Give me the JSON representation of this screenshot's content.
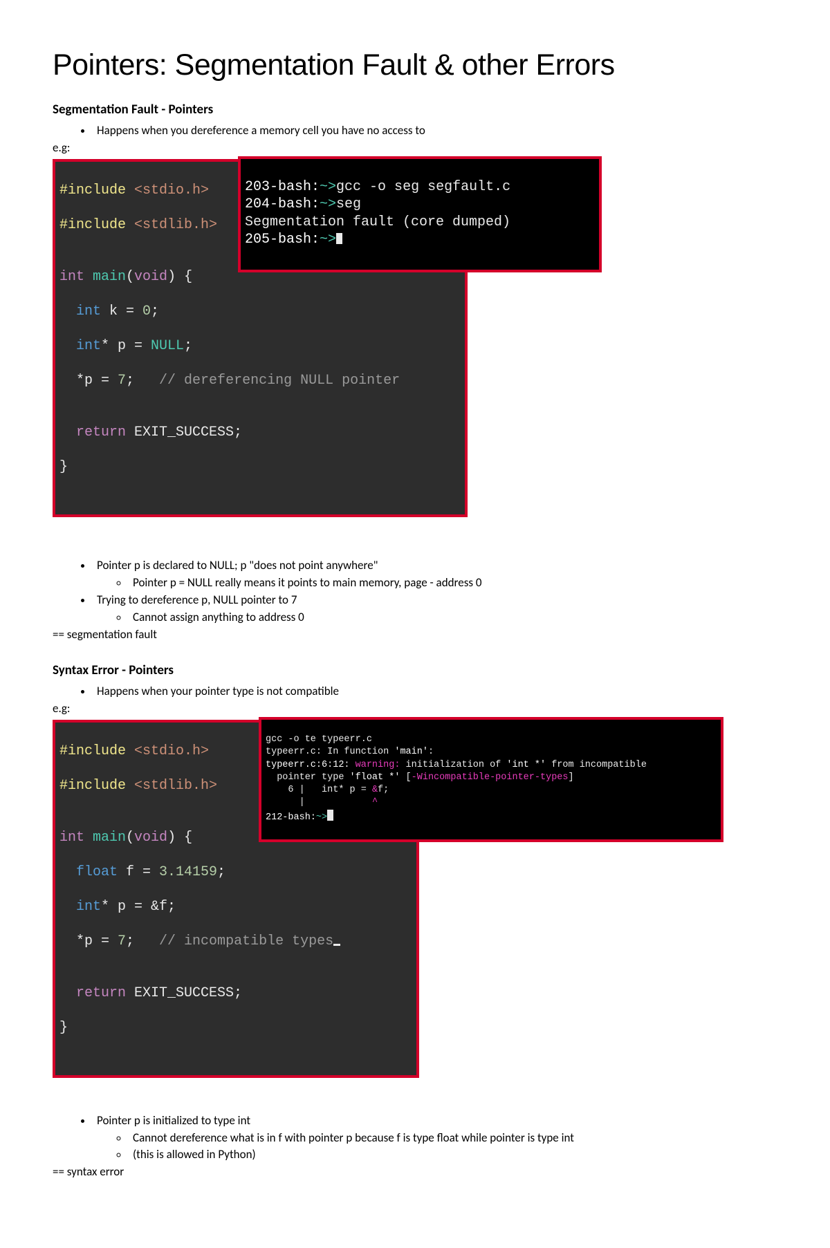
{
  "title": "Pointers: Segmentation Fault & other Errors",
  "section1": {
    "heading": "Segmentation Fault - Pointers",
    "bullet1": "Happens when you dereference a memory cell you have no access to",
    "eg": "e.g:",
    "code": {
      "l1a": "#include",
      "l1b": " <stdio.h>",
      "l2a": "#include",
      "l2b": " <stdlib.h>",
      "l3": "",
      "l4a": "int",
      "l4b": " main",
      "l4c": "(",
      "l4d": "void",
      "l4e": ") {",
      "l5a": "  int",
      "l5b": " k = ",
      "l5c": "0",
      "l5d": ";",
      "l6a": "  int",
      "l6b": "* p = ",
      "l6c": "NULL",
      "l6d": ";",
      "l7a": "  *p = ",
      "l7b": "7",
      "l7c": ";   ",
      "l7d": "// dereferencing NULL pointer",
      "l8": "",
      "l9a": "  return",
      "l9b": " EXIT_SUCCESS;",
      "l10": "}"
    },
    "term": {
      "t1a": "203-bash:",
      "t1b": "~>",
      "t1c": "gcc -o seg segfault.c",
      "t2a": "204-bash:",
      "t2b": "~>",
      "t2c": "seg",
      "t3": "Segmentation fault (core dumped)",
      "t4a": "205-bash:",
      "t4b": "~>"
    },
    "b2": "Pointer p is declared to NULL; p \"does not point anywhere\"",
    "b2s1": "Pointer p = NULL really means it points to main memory, page - address 0",
    "b3": "Trying to dereference p, NULL pointer to 7",
    "b3s1": "Cannot assign anything to address 0",
    "eq": "== segmentation fault"
  },
  "section2": {
    "heading": "Syntax Error - Pointers",
    "bullet1": "Happens when your pointer type is not compatible",
    "eg": "e.g:",
    "code": {
      "l1a": "#include",
      "l1b": " <stdio.h>",
      "l2a": "#include",
      "l2b": " <stdlib.h>",
      "l3": "",
      "l4a": "int",
      "l4b": " main",
      "l4c": "(",
      "l4d": "void",
      "l4e": ") {",
      "l5a": "  float",
      "l5b": " f = ",
      "l5c": "3.14159",
      "l5d": ";",
      "l6a": "  int",
      "l6b": "* p = &f;",
      "l7a": "  *p = ",
      "l7b": "7",
      "l7c": ";   ",
      "l7d": "// incompatible types",
      "l8": "",
      "l9a": "  return",
      "l9b": " EXIT_SUCCESS;",
      "l10": "}"
    },
    "term": {
      "t1": "gcc -o te typeerr.c",
      "t2a": "typeerr.c: In function ",
      "t2b": "'main'",
      "t2c": ":",
      "t3a": "typeerr.c:6:12: ",
      "t3b": "warning: ",
      "t3c": "initialization of ",
      "t3d": "'int *'",
      "t3e": " from incompatible",
      "t4a": "  pointer type ",
      "t4b": "'float *'",
      "t4c": " [",
      "t4d": "-Wincompatible-pointer-types",
      "t4e": "]",
      "t5a": "    6 |   int* p = ",
      "t5b": "&",
      "t5c": "f;",
      "t6": "      |            ",
      "t6b": "^",
      "t7a": "212-bash:",
      "t7b": "~>"
    },
    "b2": "Pointer p is initialized to type int",
    "b2s1": "Cannot dereference what is in f with pointer p because f is type float while pointer is type int",
    "b2s2": "(this is allowed in Python)",
    "eq": "== syntax error"
  }
}
